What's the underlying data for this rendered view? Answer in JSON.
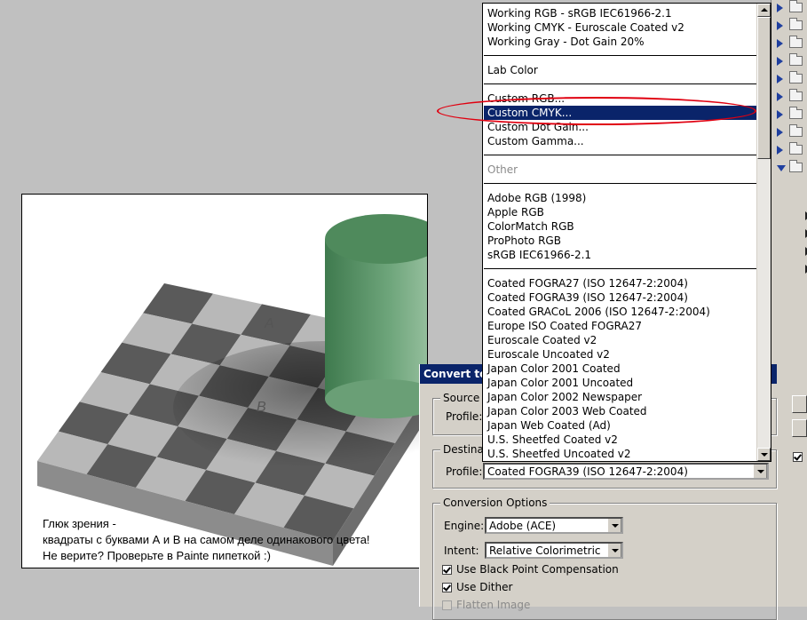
{
  "canvas": {
    "labels": {
      "a": "A",
      "b": "B"
    },
    "caption": [
      "Глюк зрения -",
      "квадраты с буквами А и В на самом деле одинакового цвета!",
      "Не верите? Проверьте в Painte пипеткой :)"
    ]
  },
  "dialog": {
    "title": "Convert to P",
    "source": {
      "label": "Source",
      "profile_label": "Profile:"
    },
    "destination": {
      "label": "Destina",
      "profile_label": "Profile:",
      "profile_value": "Coated FOGRA39 (ISO 12647-2:2004)"
    },
    "options": {
      "label": "Conversion Options",
      "engine_label": "Engine:",
      "engine_value": "Adobe (ACE)",
      "intent_label": "Intent:",
      "intent_value": "Relative Colorimetric",
      "black_point": "Use Black Point Compensation",
      "dither": "Use Dither",
      "flatten": "Flatten Image"
    }
  },
  "dropdown": {
    "selected": "Custom CMYK...",
    "items": [
      "Working RGB - sRGB IEC61966-2.1",
      "Working CMYK - Euroscale Coated v2",
      "Working Gray - Dot Gain 20%",
      "Lab Color",
      "Custom RGB...",
      "Custom CMYK...",
      "Custom Dot Gain...",
      "Custom Gamma...",
      "Other",
      "Adobe RGB (1998)",
      "Apple RGB",
      "ColorMatch RGB",
      "ProPhoto RGB",
      "sRGB IEC61966-2.1",
      "Coated FOGRA27 (ISO 12647-2:2004)",
      "Coated FOGRA39 (ISO 12647-2:2004)",
      "Coated GRACoL 2006 (ISO 12647-2:2004)",
      "Europe ISO Coated FOGRA27",
      "Euroscale Coated v2",
      "Euroscale Uncoated v2",
      "Japan Color 2001 Coated",
      "Japan Color 2001 Uncoated",
      "Japan Color 2002 Newspaper",
      "Japan Color 2003 Web Coated",
      "Japan Web Coated (Ad)",
      "U.S. Sheetfed Coated v2",
      "U.S. Sheetfed Uncoated v2"
    ]
  },
  "colors": {
    "highlight": "#0a246a",
    "annotation": "#e00010",
    "cylinder": "#5f9a6a"
  },
  "icons": [
    "folder-icon",
    "expand-triangle-icon",
    "close-icon",
    "dropdown-arrow-icon",
    "checkbox-icon"
  ]
}
